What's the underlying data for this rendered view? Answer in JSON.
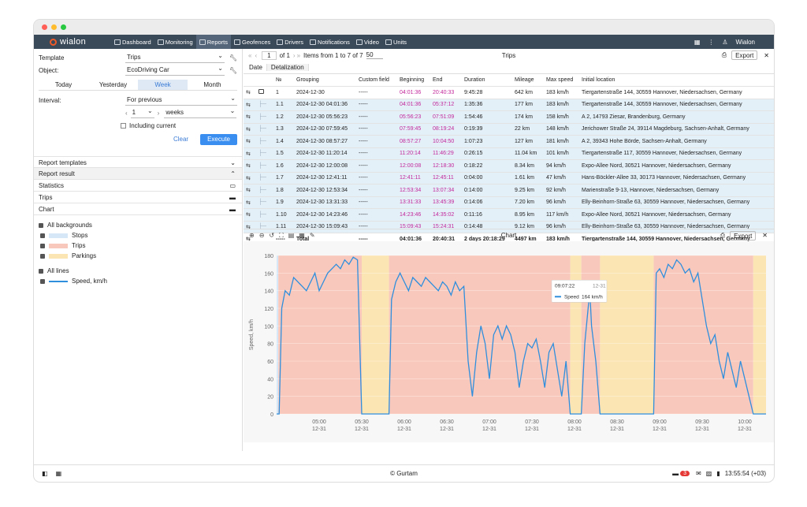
{
  "nav": {
    "logo": "wialon",
    "items": [
      "Dashboard",
      "Monitoring",
      "Reports",
      "Geofences",
      "Drivers",
      "Notifications",
      "Video",
      "Units"
    ],
    "user": "Wialon"
  },
  "form": {
    "template_label": "Template",
    "template_value": "Trips",
    "object_label": "Object:",
    "object_value": "EcoDriving Car",
    "periods": [
      "Today",
      "Yesterday",
      "Week",
      "Month"
    ],
    "interval_label": "Interval:",
    "interval_value": "For previous",
    "count": "1",
    "unit": "weeks",
    "including": "Including current",
    "clear": "Clear",
    "execute": "Execute"
  },
  "sections": {
    "report_templates": "Report templates",
    "report_result": "Report result",
    "statistics": "Statistics",
    "trips": "Trips",
    "chart": "Chart"
  },
  "legend": {
    "all_backgrounds": "All backgrounds",
    "stops": "Stops",
    "trips": "Trips",
    "parkings": "Parkings",
    "all_lines": "All lines",
    "speed": "Speed, km/h",
    "colors": {
      "stops": "#d6e8f7",
      "trips": "#f9c8bc",
      "parkings": "#fbe5b2",
      "line": "#2f8fdd"
    }
  },
  "table_toolbar": {
    "page": "1",
    "of": "of 1",
    "items": "Items from 1 to 7 of 7",
    "per_page": "50",
    "title": "Trips",
    "export": "Export"
  },
  "tabs": [
    "Date",
    "Detalization"
  ],
  "columns": [
    "№",
    "Grouping",
    "Custom field",
    "Beginning",
    "End",
    "Duration",
    "Mileage",
    "Max speed",
    "Initial location"
  ],
  "rows": [
    {
      "n": "1",
      "g": "2024-12-30",
      "c": "-----",
      "b": "04:01:36",
      "e": "20:40:33",
      "d": "9:45:28",
      "m": "642 km",
      "s": "183 km/h",
      "l": "Tiergartenstraße 144, 30559 Hannover, Niedersachsen, Germany",
      "child": false
    },
    {
      "n": "1.1",
      "g": "2024-12-30 04:01:36",
      "c": "-----",
      "b": "04:01:36",
      "e": "05:37:12",
      "d": "1:35:36",
      "m": "177 km",
      "s": "183 km/h",
      "l": "Tiergartenstraße 144, 30559 Hannover, Niedersachsen, Germany",
      "child": true
    },
    {
      "n": "1.2",
      "g": "2024-12-30 05:56:23",
      "c": "-----",
      "b": "05:56:23",
      "e": "07:51:09",
      "d": "1:54:46",
      "m": "174 km",
      "s": "158 km/h",
      "l": "A 2, 14793 Ziesar, Brandenburg, Germany",
      "child": true
    },
    {
      "n": "1.3",
      "g": "2024-12-30 07:59:45",
      "c": "-----",
      "b": "07:59:45",
      "e": "08:19:24",
      "d": "0:19:39",
      "m": "22 km",
      "s": "148 km/h",
      "l": "Jerichower Straße 24, 39114 Magdeburg, Sachsen-Anhalt, Germany",
      "child": true
    },
    {
      "n": "1.4",
      "g": "2024-12-30 08:57:27",
      "c": "-----",
      "b": "08:57:27",
      "e": "10:04:50",
      "d": "1:07:23",
      "m": "127 km",
      "s": "181 km/h",
      "l": "A 2, 39343 Hohe Börde, Sachsen-Anhalt, Germany",
      "child": true
    },
    {
      "n": "1.5",
      "g": "2024-12-30 11:20:14",
      "c": "-----",
      "b": "11:20:14",
      "e": "11:46:29",
      "d": "0:26:15",
      "m": "11.04 km",
      "s": "101 km/h",
      "l": "Tiergartenstraße 117, 30559 Hannover, Niedersachsen, Germany",
      "child": true
    },
    {
      "n": "1.6",
      "g": "2024-12-30 12:00:08",
      "c": "-----",
      "b": "12:00:08",
      "e": "12:18:30",
      "d": "0:18:22",
      "m": "8.34 km",
      "s": "94 km/h",
      "l": "Expo-Allee Nord, 30521 Hannover, Niedersachsen, Germany",
      "child": true
    },
    {
      "n": "1.7",
      "g": "2024-12-30 12:41:11",
      "c": "-----",
      "b": "12:41:11",
      "e": "12:45:11",
      "d": "0:04:00",
      "m": "1.61 km",
      "s": "47 km/h",
      "l": "Hans-Böckler-Allee 33, 30173 Hannover, Niedersachsen, Germany",
      "child": true
    },
    {
      "n": "1.8",
      "g": "2024-12-30 12:53:34",
      "c": "-----",
      "b": "12:53:34",
      "e": "13:07:34",
      "d": "0:14:00",
      "m": "9.25 km",
      "s": "92 km/h",
      "l": "Marienstraße 9-13, Hannover, Niedersachsen, Germany",
      "child": true
    },
    {
      "n": "1.9",
      "g": "2024-12-30 13:31:33",
      "c": "-----",
      "b": "13:31:33",
      "e": "13:45:39",
      "d": "0:14:06",
      "m": "7.20 km",
      "s": "96 km/h",
      "l": "Elly-Beinhorn-Straße 63, 30559 Hannover, Niedersachsen, Germany",
      "child": true
    },
    {
      "n": "1.10",
      "g": "2024-12-30 14:23:46",
      "c": "-----",
      "b": "14:23:46",
      "e": "14:35:02",
      "d": "0:11:16",
      "m": "8.95 km",
      "s": "117 km/h",
      "l": "Expo-Allee Nord, 30521 Hannover, Niedersachsen, Germany",
      "child": true
    },
    {
      "n": "1.11",
      "g": "2024-12-30 15:09:43",
      "c": "-----",
      "b": "15:09:43",
      "e": "15:24:31",
      "d": "0:14:48",
      "m": "9.12 km",
      "s": "96 km/h",
      "l": "Elly-Beinhorn-Straße 63, 30559 Hannover, Niedersachsen, Germany",
      "child": true
    }
  ],
  "total": {
    "n": "-----",
    "g": "Total",
    "c": "-----",
    "b": "04:01:36",
    "e": "20:40:31",
    "d": "2 days 20:18:29",
    "m": "4497 km",
    "s": "183 km/h",
    "l": "Tiergartenstraße 144, 30559 Hannover, Niedersachsen, Germany"
  },
  "chart_toolbar": {
    "title": "Chart",
    "export": "Export"
  },
  "chart_data": {
    "type": "line",
    "ylabel": "Speed, km/h",
    "ylim": [
      0,
      180
    ],
    "yticks": [
      0,
      20,
      40,
      60,
      80,
      100,
      120,
      140,
      160,
      180
    ],
    "xticks": [
      {
        "t": "05:00",
        "d": "12-31",
        "h": 5.0
      },
      {
        "t": "05:30",
        "d": "12-31",
        "h": 5.5
      },
      {
        "t": "06:00",
        "d": "12-31",
        "h": 6.0
      },
      {
        "t": "06:30",
        "d": "12-31",
        "h": 6.5
      },
      {
        "t": "07:00",
        "d": "12-31",
        "h": 7.0
      },
      {
        "t": "07:30",
        "d": "12-31",
        "h": 7.5
      },
      {
        "t": "08:00",
        "d": "12-31",
        "h": 8.0
      },
      {
        "t": "08:30",
        "d": "12-31",
        "h": 8.5
      },
      {
        "t": "09:00",
        "d": "12-31",
        "h": 9.0
      },
      {
        "t": "09:30",
        "d": "12-31",
        "h": 9.5
      },
      {
        "t": "10:00",
        "d": "12-31",
        "h": 10.0
      }
    ],
    "xlim": [
      4.5,
      10.25
    ],
    "bands": [
      {
        "type": "stops",
        "from": 4.5,
        "to": 4.52
      },
      {
        "type": "trips",
        "from": 4.52,
        "to": 5.5
      },
      {
        "type": "parkings",
        "from": 5.5,
        "to": 5.82
      },
      {
        "type": "trips",
        "from": 5.82,
        "to": 7.95
      },
      {
        "type": "parkings",
        "from": 7.95,
        "to": 8.08
      },
      {
        "type": "trips",
        "from": 8.08,
        "to": 8.3
      },
      {
        "type": "parkings",
        "from": 8.3,
        "to": 8.93
      },
      {
        "type": "trips",
        "from": 8.93,
        "to": 10.1
      },
      {
        "type": "parkings",
        "from": 10.1,
        "to": 10.25
      }
    ],
    "series": [
      {
        "values": [
          [
            4.5,
            0
          ],
          [
            4.53,
            0
          ],
          [
            4.56,
            120
          ],
          [
            4.6,
            140
          ],
          [
            4.65,
            135
          ],
          [
            4.7,
            155
          ],
          [
            4.75,
            150
          ],
          [
            4.8,
            145
          ],
          [
            4.85,
            140
          ],
          [
            4.9,
            150
          ],
          [
            4.95,
            160
          ],
          [
            5.0,
            140
          ],
          [
            5.05,
            150
          ],
          [
            5.1,
            160
          ],
          [
            5.15,
            165
          ],
          [
            5.2,
            170
          ],
          [
            5.25,
            165
          ],
          [
            5.3,
            175
          ],
          [
            5.35,
            170
          ],
          [
            5.4,
            178
          ],
          [
            5.45,
            175
          ],
          [
            5.5,
            0
          ],
          [
            5.82,
            0
          ],
          [
            5.85,
            130
          ],
          [
            5.9,
            150
          ],
          [
            5.95,
            160
          ],
          [
            6.0,
            150
          ],
          [
            6.05,
            140
          ],
          [
            6.1,
            155
          ],
          [
            6.15,
            150
          ],
          [
            6.2,
            145
          ],
          [
            6.25,
            155
          ],
          [
            6.3,
            150
          ],
          [
            6.35,
            145
          ],
          [
            6.4,
            140
          ],
          [
            6.45,
            150
          ],
          [
            6.5,
            145
          ],
          [
            6.55,
            135
          ],
          [
            6.6,
            150
          ],
          [
            6.65,
            140
          ],
          [
            6.7,
            145
          ],
          [
            6.75,
            60
          ],
          [
            6.8,
            20
          ],
          [
            6.85,
            70
          ],
          [
            6.9,
            100
          ],
          [
            6.95,
            80
          ],
          [
            7.0,
            40
          ],
          [
            7.05,
            90
          ],
          [
            7.1,
            100
          ],
          [
            7.15,
            85
          ],
          [
            7.2,
            100
          ],
          [
            7.25,
            90
          ],
          [
            7.3,
            70
          ],
          [
            7.35,
            30
          ],
          [
            7.4,
            60
          ],
          [
            7.45,
            80
          ],
          [
            7.5,
            75
          ],
          [
            7.55,
            85
          ],
          [
            7.6,
            60
          ],
          [
            7.65,
            30
          ],
          [
            7.7,
            70
          ],
          [
            7.75,
            80
          ],
          [
            7.8,
            50
          ],
          [
            7.85,
            20
          ],
          [
            7.9,
            60
          ],
          [
            7.95,
            0
          ],
          [
            8.08,
            0
          ],
          [
            8.12,
            80
          ],
          [
            8.15,
            110
          ],
          [
            8.18,
            140
          ],
          [
            8.2,
            100
          ],
          [
            8.25,
            60
          ],
          [
            8.3,
            0
          ],
          [
            8.93,
            0
          ],
          [
            8.96,
            160
          ],
          [
            9.0,
            165
          ],
          [
            9.05,
            155
          ],
          [
            9.1,
            170
          ],
          [
            9.15,
            165
          ],
          [
            9.2,
            175
          ],
          [
            9.25,
            170
          ],
          [
            9.3,
            160
          ],
          [
            9.35,
            165
          ],
          [
            9.4,
            150
          ],
          [
            9.45,
            160
          ],
          [
            9.5,
            130
          ],
          [
            9.55,
            100
          ],
          [
            9.6,
            80
          ],
          [
            9.65,
            90
          ],
          [
            9.7,
            60
          ],
          [
            9.75,
            40
          ],
          [
            9.8,
            70
          ],
          [
            9.85,
            50
          ],
          [
            9.9,
            30
          ],
          [
            9.95,
            60
          ],
          [
            10.0,
            40
          ],
          [
            10.05,
            20
          ],
          [
            10.1,
            0
          ],
          [
            10.25,
            0
          ]
        ]
      }
    ],
    "tooltip": {
      "time": "09:07:22",
      "date": "12-31",
      "series": "Speed",
      "value": "164 km/h"
    }
  },
  "footer": {
    "copyright": "© Gurtam",
    "badge": "3",
    "clock": "13:55:54 (+03)"
  }
}
